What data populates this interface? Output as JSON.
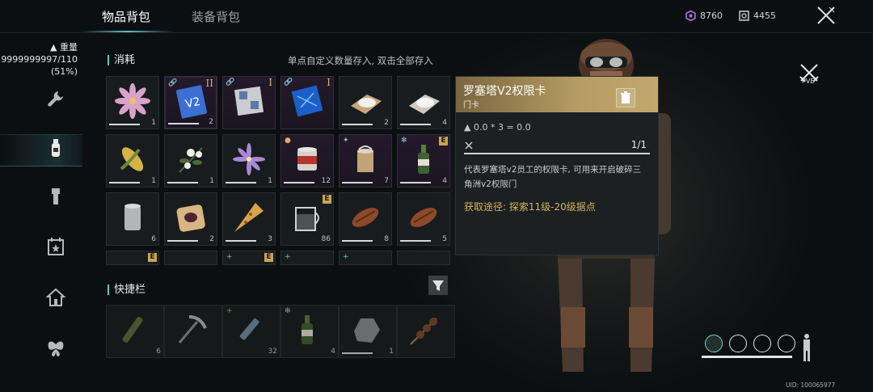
{
  "tabs": [
    {
      "label": "物品背包",
      "active": true
    },
    {
      "label": "装备背包",
      "active": false
    }
  ],
  "currency": [
    {
      "icon": "purple-hex-coin-icon",
      "value": "8760",
      "color": "#b56ee0"
    },
    {
      "icon": "bracket-coin-icon",
      "value": "4455",
      "color": "#d9dbdc"
    }
  ],
  "weight": {
    "label": "重量",
    "value": "9999999997/110",
    "percent": "(51%)"
  },
  "sidebar": [
    "wrench-icon",
    "bottle-icon",
    "flashlight-icon",
    "calendar-star-icon",
    "house-icon",
    "butterfly-icon"
  ],
  "consumables": {
    "title": "消耗",
    "hint": "单点自定义数量存入, 双击全部存入",
    "items": [
      {
        "name": "flower-pink",
        "qty": "1",
        "fill": 1.0
      },
      {
        "name": "v2-access-card",
        "qty": "2",
        "rank": "II",
        "linked": true,
        "selected": true,
        "fill": 1.0
      },
      {
        "name": "keycard-map",
        "qty": "",
        "rank": "I",
        "linked": true,
        "fill": 0
      },
      {
        "name": "blue-keycard",
        "qty": "",
        "rank": "I",
        "linked": true,
        "fill": 0
      },
      {
        "name": "salt-bag",
        "qty": "2",
        "fill": 1.0
      },
      {
        "name": "sugar-bag",
        "qty": "4",
        "fill": 1.0
      },
      {
        "name": "corn",
        "qty": "1",
        "fill": 1.0
      },
      {
        "name": "white-flower",
        "qty": "1",
        "fill": 1.0
      },
      {
        "name": "purple-flower",
        "qty": "1",
        "fill": 1.0
      },
      {
        "name": "canned-meat",
        "qty": "12",
        "fill": 1.0
      },
      {
        "name": "open-can",
        "qty": "7",
        "fill": 1.0
      },
      {
        "name": "green-bottle",
        "qty": "4",
        "e": true,
        "fill": 1.0
      },
      {
        "name": "metal-can",
        "qty": "6",
        "fill": 0
      },
      {
        "name": "jam-toast",
        "qty": "2",
        "fill": 1.0
      },
      {
        "name": "pizza-slice",
        "qty": "3",
        "fill": 1.0
      },
      {
        "name": "water-glass",
        "qty": "86",
        "e": true,
        "fill": 0
      },
      {
        "name": "grilled-meat",
        "qty": "8",
        "fill": 1.0
      },
      {
        "name": "grilled-meat-2",
        "qty": "5",
        "fill": 1.0
      }
    ]
  },
  "quickbar": {
    "title": "快捷栏",
    "items": [
      {
        "name": "bottle-club",
        "qty": "6"
      },
      {
        "name": "pickaxe",
        "qty": ""
      },
      {
        "name": "syringe",
        "qty": "32"
      },
      {
        "name": "green-bottle",
        "qty": "4"
      },
      {
        "name": "rock",
        "qty": "1"
      },
      {
        "name": "skewer",
        "qty": ""
      }
    ]
  },
  "detail": {
    "name": "罗塞塔V2权限卡",
    "type": "门卡",
    "weight_formula": "0.0 * 3 = 0.0",
    "durability": "1/1",
    "description_line1": "代表罗塞塔v2员工的权限卡, 可用来开启破碎三",
    "description_line2": "角洲v2权限门",
    "source": "获取途径: 探索11级-20级据点"
  },
  "pve_label": "PVE",
  "uid": "UID: 100065977"
}
